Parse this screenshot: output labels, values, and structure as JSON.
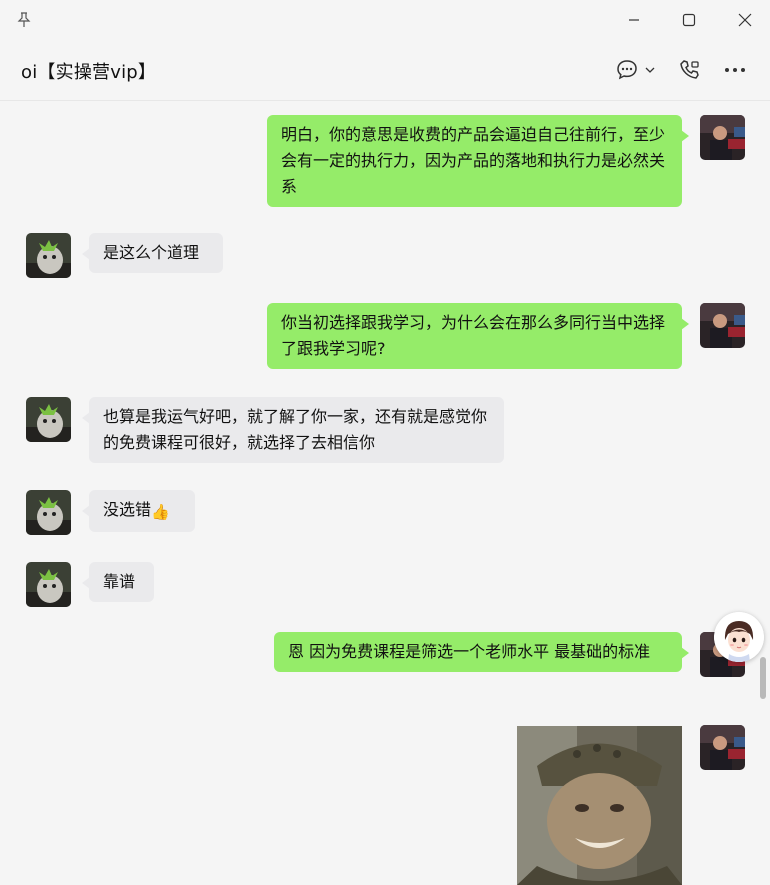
{
  "window": {
    "pin_icon": "pin-icon",
    "minimize_icon": "minimize-icon",
    "maximize_icon": "maximize-icon",
    "close_icon": "close-icon"
  },
  "header": {
    "title": "oi【实操营vip】",
    "icons": [
      "chat-bubble-icon",
      "chevron-down-icon",
      "phone-video-icon",
      "more-icon"
    ]
  },
  "messages": [
    {
      "side": "out",
      "text": "明白，你的意思是收费的产品会逼迫自己往前行，至少会有一定的执行力，因为产品的落地和执行力是必然关系"
    },
    {
      "side": "in",
      "text": "是这么个道理"
    },
    {
      "side": "out",
      "text": "你当初选择跟我学习，为什么会在那么多同行当中选择了跟我学习呢?"
    },
    {
      "side": "in",
      "text": "也算是我运气好吧，就了解了你一家，还有就是感觉你的免费课程可很好，就选择了去相信你"
    },
    {
      "side": "in",
      "text": "没选错",
      "emoji": "👍"
    },
    {
      "side": "in",
      "text": "靠谱"
    },
    {
      "side": "out",
      "text": "恩 因为免费课程是筛选一个老师水平 最基础的标准"
    },
    {
      "side": "out",
      "type": "image",
      "description_icon": "photo-message"
    }
  ],
  "colors": {
    "outgoing_bubble": "#95ec69",
    "incoming_bubble": "#eaeaec",
    "background": "#f5f5f5"
  }
}
